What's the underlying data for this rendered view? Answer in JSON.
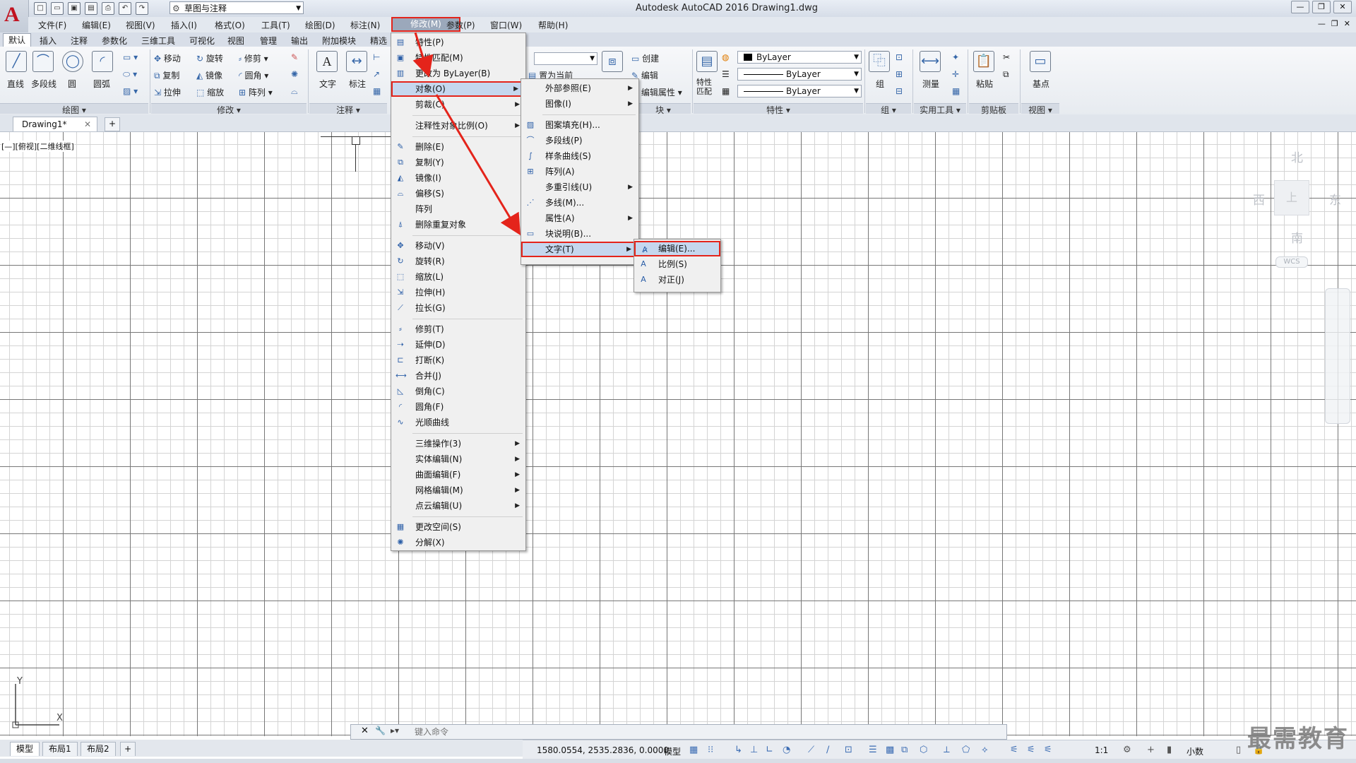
{
  "titlebar": {
    "workspace": "草图与注释",
    "app_title": "Autodesk AutoCAD 2016    Drawing1.dwg",
    "window_controls": [
      "—",
      "❐",
      "✕"
    ]
  },
  "menubar": {
    "items": [
      "文件(F)",
      "编辑(E)",
      "视图(V)",
      "插入(I)",
      "格式(O)",
      "工具(T)",
      "绘图(D)",
      "标注(N)",
      "修改(M)",
      "参数(P)",
      "窗口(W)",
      "帮助(H)"
    ]
  },
  "ribbon_tabs": [
    "默认",
    "插入",
    "注释",
    "参数化",
    "三维工具",
    "可视化",
    "视图",
    "管理",
    "输出",
    "附加模块",
    "精选"
  ],
  "ribbon": {
    "draw": {
      "line": "直线",
      "polyline": "多段线",
      "circle": "圆",
      "arc": "圆弧",
      "title": "绘图"
    },
    "modify": {
      "move": "移动",
      "rotate": "旋转",
      "trim": "修剪",
      "copy": "复制",
      "mirror": "镜像",
      "fillet": "圆角",
      "stretch": "拉伸",
      "scale": "缩放",
      "array": "阵列",
      "title": "修改"
    },
    "annotation": {
      "text": "文字",
      "dim": "标注",
      "title": "注释"
    },
    "layers": {
      "set_current": "置为当前"
    },
    "block": {
      "create": "创建",
      "edit": "编辑",
      "edit_attr": "编辑属性",
      "title": "块"
    },
    "properties": {
      "match": "特性匹配",
      "color": "ByLayer",
      "linetype": "ByLayer",
      "lineweight": "ByLayer",
      "title": "特性"
    },
    "groups": {
      "group": "组",
      "title": "组"
    },
    "utilities": {
      "measure": "测量",
      "title": "实用工具"
    },
    "clipboard": {
      "paste": "粘贴",
      "title": "剪贴板"
    },
    "view": {
      "base": "基点",
      "title": "视图"
    }
  },
  "filetabs": {
    "doc": "Drawing1*"
  },
  "viewport": {
    "label": "[—][俯视][二维线框]",
    "viewcube": {
      "north": "北",
      "south": "南",
      "east": "东",
      "west": "西",
      "face": "上",
      "wcs": "WCS"
    }
  },
  "modify_menu": [
    {
      "label": "特性(P)",
      "icon": "properties-icon",
      "glyph": "▤"
    },
    {
      "label": "特性匹配(M)",
      "icon": "match-properties-icon",
      "glyph": "▣"
    },
    {
      "label": "更改为 ByLayer(B)",
      "icon": "bylayer-icon",
      "glyph": "▥"
    },
    {
      "label": "对象(O)",
      "icon": "",
      "glyph": "",
      "sub": true,
      "highlight": true
    },
    {
      "label": "剪裁(C)",
      "icon": "",
      "glyph": "",
      "sub": true
    },
    {
      "label": "注释性对象比例(O)",
      "icon": "",
      "glyph": "",
      "sub": true,
      "sep_before": true
    },
    {
      "label": "删除(E)",
      "icon": "erase-icon",
      "glyph": "✎",
      "sep_before": true
    },
    {
      "label": "复制(Y)",
      "icon": "copy-icon",
      "glyph": "⧉"
    },
    {
      "label": "镜像(I)",
      "icon": "mirror-icon",
      "glyph": "◭"
    },
    {
      "label": "偏移(S)",
      "icon": "offset-icon",
      "glyph": "⌓"
    },
    {
      "label": "阵列",
      "icon": "",
      "glyph": ""
    },
    {
      "label": "删除重复对象",
      "icon": "delete-duplicates-icon",
      "glyph": "⍋"
    },
    {
      "label": "移动(V)",
      "icon": "move-icon",
      "glyph": "✥",
      "sep_before": true
    },
    {
      "label": "旋转(R)",
      "icon": "rotate-icon",
      "glyph": "↻"
    },
    {
      "label": "缩放(L)",
      "icon": "scale-icon",
      "glyph": "⬚"
    },
    {
      "label": "拉伸(H)",
      "icon": "stretch-icon",
      "glyph": "⇲"
    },
    {
      "label": "拉长(G)",
      "icon": "lengthen-icon",
      "glyph": "⟋"
    },
    {
      "label": "修剪(T)",
      "icon": "trim-icon",
      "glyph": "⸗",
      "sep_before": true
    },
    {
      "label": "延伸(D)",
      "icon": "extend-icon",
      "glyph": "⇢"
    },
    {
      "label": "打断(K)",
      "icon": "break-icon",
      "glyph": "⊏"
    },
    {
      "label": "合并(J)",
      "icon": "join-icon",
      "glyph": "⟷"
    },
    {
      "label": "倒角(C)",
      "icon": "chamfer-icon",
      "glyph": "◺"
    },
    {
      "label": "圆角(F)",
      "icon": "fillet-icon",
      "glyph": "◜"
    },
    {
      "label": "光顺曲线",
      "icon": "blend-curves-icon",
      "glyph": "∿"
    },
    {
      "label": "三维操作(3)",
      "icon": "",
      "glyph": "",
      "sub": true,
      "sep_before": true
    },
    {
      "label": "实体编辑(N)",
      "icon": "",
      "glyph": "",
      "sub": true
    },
    {
      "label": "曲面编辑(F)",
      "icon": "",
      "glyph": "",
      "sub": true
    },
    {
      "label": "网格编辑(M)",
      "icon": "",
      "glyph": "",
      "sub": true
    },
    {
      "label": "点云编辑(U)",
      "icon": "",
      "glyph": "",
      "sub": true
    },
    {
      "label": "更改空间(S)",
      "icon": "change-space-icon",
      "glyph": "▦",
      "sep_before": true
    },
    {
      "label": "分解(X)",
      "icon": "explode-icon",
      "glyph": "✺"
    }
  ],
  "object_menu": [
    {
      "label": "外部参照(E)",
      "icon": "",
      "glyph": "",
      "sub": true
    },
    {
      "label": "图像(I)",
      "icon": "",
      "glyph": "",
      "sub": true
    },
    {
      "label": "图案填充(H)...",
      "icon": "hatch-icon",
      "glyph": "▨",
      "sep_before": true
    },
    {
      "label": "多段线(P)",
      "icon": "polyline-icon",
      "glyph": "⌒"
    },
    {
      "label": "样条曲线(S)",
      "icon": "spline-icon",
      "glyph": "∫"
    },
    {
      "label": "阵列(A)",
      "icon": "array-icon",
      "glyph": "⊞"
    },
    {
      "label": "多重引线(U)",
      "icon": "",
      "glyph": "",
      "sub": true
    },
    {
      "label": "多线(M)...",
      "icon": "multiline-icon",
      "glyph": "⋰"
    },
    {
      "label": "属性(A)",
      "icon": "",
      "glyph": "",
      "sub": true
    },
    {
      "label": "块说明(B)...",
      "icon": "block-description-icon",
      "glyph": "▭"
    },
    {
      "label": "文字(T)",
      "icon": "",
      "glyph": "",
      "sub": true,
      "highlight": true
    }
  ],
  "text_menu": [
    {
      "label": "编辑(E)...",
      "icon": "edit-text-icon",
      "glyph": "A̷",
      "highlight": true
    },
    {
      "label": "比例(S)",
      "icon": "scale-text-icon",
      "glyph": "A"
    },
    {
      "label": "对正(J)",
      "icon": "justify-text-icon",
      "glyph": "A"
    }
  ],
  "command_line": {
    "prompt": "▸▾",
    "placeholder": "键入命令"
  },
  "layout_tabs": [
    "模型",
    "布局1",
    "布局2"
  ],
  "status_bar": {
    "coords": "1580.0554, 2535.2836, 0.0000",
    "model": "模型",
    "scale": "1:1",
    "units": "小数"
  },
  "watermark": "最需教育",
  "colors": {
    "highlight_border": "#e4241b",
    "menu_bg": "#f0f0f0",
    "accent": "#c1121f"
  }
}
